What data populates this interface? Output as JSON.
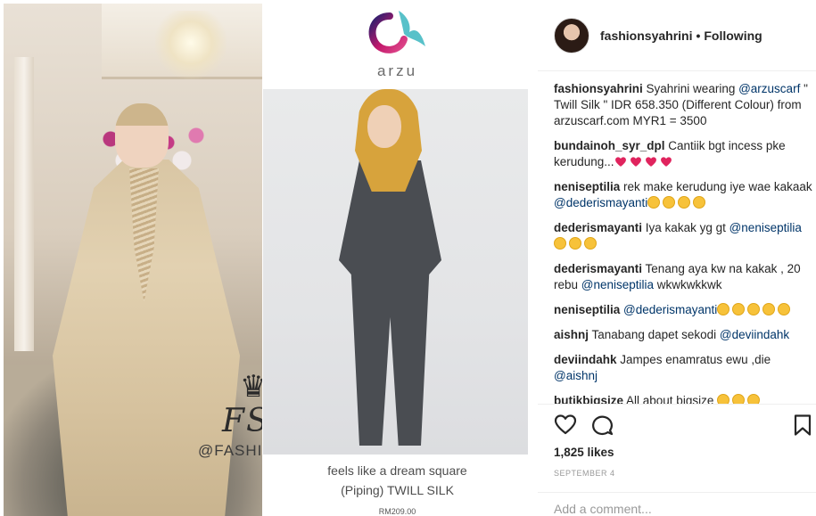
{
  "post": {
    "left_image": {
      "watermark_initials": "FSYR",
      "watermark_handle": "@FASHIONSYAHRINI"
    },
    "right_image": {
      "brand": "arzu",
      "caption_line1": "feels like a dream square",
      "caption_line2": "(Piping) TWILL SILK",
      "price": "RM209.00"
    }
  },
  "header": {
    "username": "fashionsyahrini",
    "separator": "•",
    "follow_status": "Following"
  },
  "comments": [
    {
      "user": "fashionsyahrini",
      "parts": [
        {
          "t": " Syahrini wearing "
        },
        {
          "t": "@arzuscarf",
          "mention": true
        },
        {
          "t": " \" Twill Silk \" IDR 658.350 (Different Colour) from arzuscarf.com MYR1 = 3500"
        }
      ]
    },
    {
      "user": "bundainoh_syr_dpl",
      "parts": [
        {
          "t": " Cantiik bgt incess pke kerudung..."
        }
      ],
      "hearts": 4
    },
    {
      "user": "neniseptilia",
      "parts": [
        {
          "t": " rek make kerudung iye wae kakaak "
        },
        {
          "t": "@dederismayanti",
          "mention": true
        }
      ],
      "emojis": 4
    },
    {
      "user": "dederismayanti",
      "parts": [
        {
          "t": " Iya kakak yg gt "
        },
        {
          "t": "@neniseptilia",
          "mention": true
        }
      ],
      "emojis": 3
    },
    {
      "user": "dederismayanti",
      "parts": [
        {
          "t": " Tenang aya kw na kakak , 20 rebu "
        },
        {
          "t": "@neniseptilia",
          "mention": true
        },
        {
          "t": " wkwkwkkwk"
        }
      ]
    },
    {
      "user": "neniseptilia",
      "parts": [
        {
          "t": " "
        },
        {
          "t": "@dederismayanti",
          "mention": true
        }
      ],
      "emojis": 5
    },
    {
      "user": "aishnj",
      "parts": [
        {
          "t": " Tanabang dapet sekodi "
        },
        {
          "t": "@deviindahk",
          "mention": true
        }
      ]
    },
    {
      "user": "deviindahk",
      "parts": [
        {
          "t": " Jampes enamratus ewu ,die "
        },
        {
          "t": "@aishnj",
          "mention": true
        }
      ]
    },
    {
      "user": "butikbigsize",
      "parts": [
        {
          "t": " All about bigsize "
        }
      ],
      "emojis": 3
    }
  ],
  "actions": {
    "like_icon": "heart-icon",
    "comment_icon": "comment-icon",
    "save_icon": "bookmark-icon"
  },
  "likes": "1,825 likes",
  "date": "SEPTEMBER 4",
  "add_comment": {
    "placeholder": "Add a comment..."
  },
  "colors": {
    "mention": "#003569",
    "heart": "#e0245e",
    "brand_gradient": [
      "#1f1f6e",
      "#c2186b",
      "#58c1c9"
    ]
  }
}
